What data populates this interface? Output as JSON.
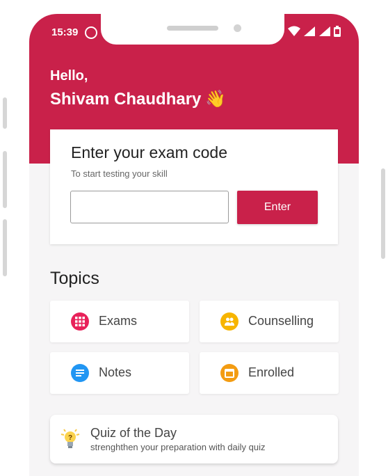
{
  "status_bar": {
    "time": "15:39"
  },
  "greeting": {
    "hello": "Hello,",
    "name": "Shivam Chaudhary",
    "emoji": "👋"
  },
  "exam_card": {
    "title": "Enter your exam code",
    "subtitle": "To start testing your skill",
    "input_value": "",
    "enter_label": "Enter"
  },
  "topics": {
    "heading": "Topics",
    "items": [
      {
        "label": "Exams",
        "icon": "grid-icon",
        "color": "#e8225a"
      },
      {
        "label": "Counselling",
        "icon": "people-icon",
        "color": "#f7b500"
      },
      {
        "label": "Notes",
        "icon": "notes-icon",
        "color": "#2196f3"
      },
      {
        "label": "Enrolled",
        "icon": "calendar-icon",
        "color": "#f39c12"
      }
    ]
  },
  "quiz": {
    "title": "Quiz of the Day",
    "subtitle": "strenghthen your preparation with daily quiz",
    "icon": "lightbulb-icon"
  },
  "colors": {
    "primary": "#c9214a",
    "background": "#f6f5f6"
  }
}
